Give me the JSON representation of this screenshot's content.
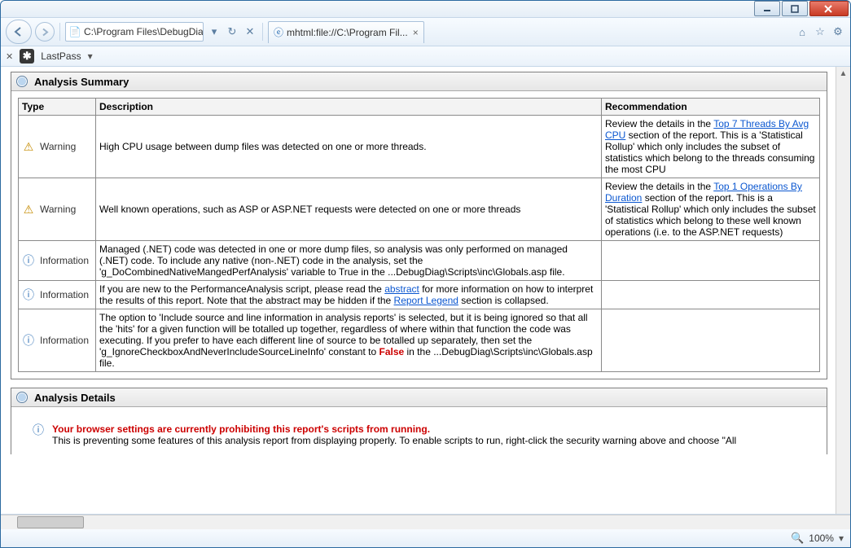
{
  "window": {
    "address": "C:\\Program Files\\DebugDiag\\F",
    "tab_title": "mhtml:file://C:\\Program Fil...",
    "zoom": "100%"
  },
  "toolbar": {
    "lastpass": "LastPass"
  },
  "summary": {
    "title": "Analysis Summary",
    "th_type": "Type",
    "th_desc": "Description",
    "th_rec": "Recommendation",
    "rows": [
      {
        "type": "Warning",
        "desc": "High CPU usage between dump files was detected on one or more threads.",
        "rec_pre": "Review the details in the ",
        "rec_link": "Top 7 Threads By Avg CPU",
        "rec_post": " section of the report. This is a 'Statistical Rollup' which only includes the subset of statistics which belong to the threads consuming the most CPU"
      },
      {
        "type": "Warning",
        "desc": "Well known operations, such as ASP or ASP.NET requests were detected on one or more threads",
        "rec_pre": "Review the details in the ",
        "rec_link": "Top 1 Operations By Duration",
        "rec_post": " section of the report. This is a 'Statistical Rollup' which only includes the subset of statistics which belong to these well known operations (i.e. to the ASP.NET requests)"
      },
      {
        "type": "Information",
        "desc": "Managed (.NET) code was detected in one or more dump files, so analysis was only performed on managed (.NET) code. To include any native (non-.NET) code in the analysis, set the 'g_DoCombinedNativeMangedPerfAnalysis' variable to True in the ...DebugDiag\\Scripts\\inc\\Globals.asp file."
      },
      {
        "type": "Information",
        "desc_pre": "If you are new to the PerformanceAnalysis script, please read the ",
        "desc_link1": "abstract",
        "desc_mid": " for more information on how to interpret the results of this report.   Note that the abstract may be hidden if the ",
        "desc_link2": "Report Legend",
        "desc_post": " section is collapsed."
      },
      {
        "type": "Information",
        "desc_pre": "The option to 'Include source and line information in analysis reports' is selected, but it is being ignored so that all the 'hits' for a given function will be totalled up together, regardless of where within that function the code was executing. If you prefer to have each different line of source to be totalled up separately, then set the 'g_IgnoreCheckboxAndNeverIncludeSourceLineInfo' constant to ",
        "desc_false": "False",
        "desc_post": " in the ...DebugDiag\\Scripts\\inc\\Globals.asp file."
      }
    ]
  },
  "details": {
    "title": "Analysis Details",
    "msg_title": "Your browser settings are currently prohibiting this report's scripts from running.",
    "msg_body": "This is preventing some features of this analysis report from displaying properly. To enable scripts to run, right-click the security warning above and choose \"All"
  }
}
